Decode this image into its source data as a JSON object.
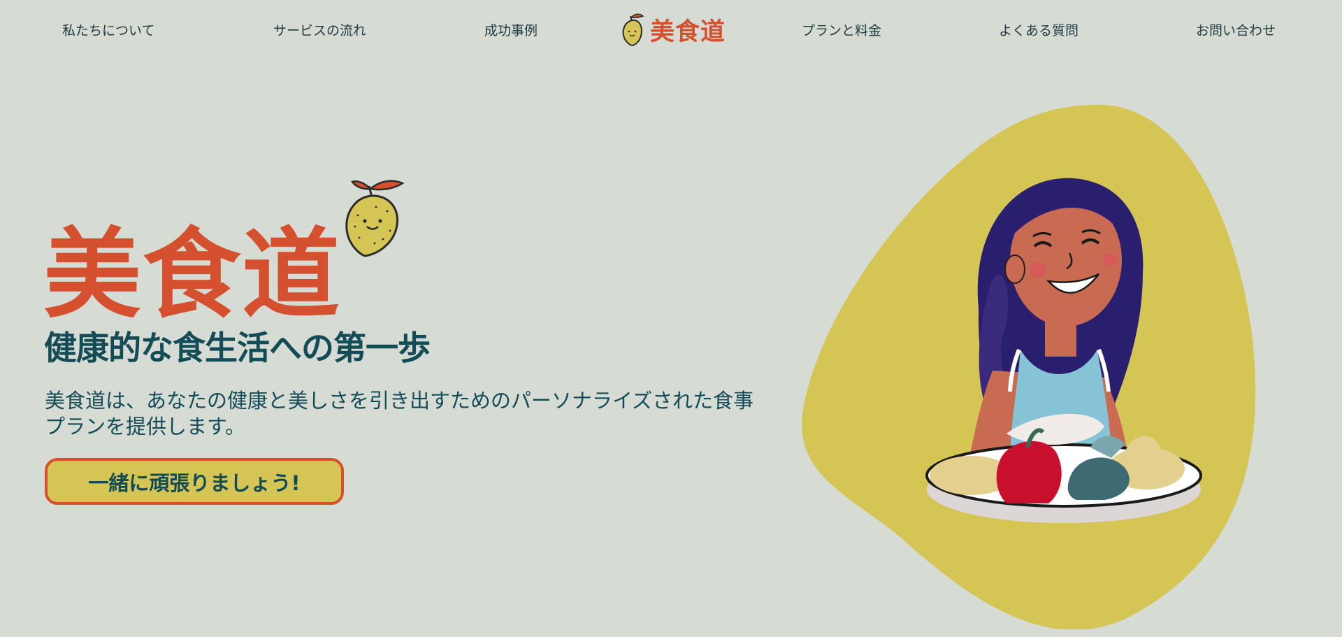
{
  "nav": {
    "items": [
      {
        "label": "私たちについて"
      },
      {
        "label": "サービスの流れ"
      },
      {
        "label": "成功事例"
      },
      {
        "label": "プランと料金"
      },
      {
        "label": "よくある質問"
      },
      {
        "label": "お問い合わせ"
      }
    ],
    "logo_text": "美食道",
    "logo_icon": "lemon-icon"
  },
  "hero": {
    "title": "美食道",
    "title_icon": "lemon-icon",
    "subtitle": "健康的な食生活への第一歩",
    "description": "美食道は、あなたの健康と美しさを引き出すためのパーソナライズされた食事プランを提供します。",
    "cta_label": "一緒に頑張りましょう!",
    "illustration": "smiling-woman-with-salad-plate"
  },
  "colors": {
    "background": "#d6dbd4",
    "brand": "#d4502e",
    "text": "#134c56",
    "accent": "#d4c555"
  }
}
